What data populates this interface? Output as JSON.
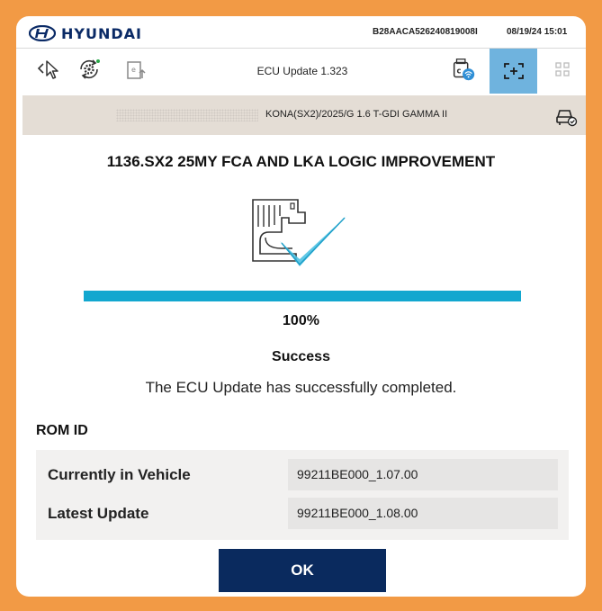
{
  "header": {
    "brand": "HYUNDAI",
    "vin": "B28AACA526240819008I",
    "datetime": "08/19/24 15:01"
  },
  "toolbar": {
    "title": "ECU Update 1.323",
    "icons": [
      "pointer-back-icon",
      "settings-sync-icon",
      "ecu-upload-icon",
      "vci-status-icon",
      "screen-capture-icon",
      "grid-icon"
    ]
  },
  "vehicle": {
    "description": "KONA(SX2)/2025/G 1.6 T-GDI GAMMA II"
  },
  "update": {
    "title": "1136.SX2 25MY FCA AND LKA LOGIC IMPROVEMENT",
    "progress": 1.0,
    "percent_text": "100%",
    "status": "Success",
    "message": "The ECU Update has successfully completed."
  },
  "rom": {
    "label": "ROM ID",
    "rows": [
      {
        "label": "Currently in Vehicle",
        "value": "99211BE000_1.07.00"
      },
      {
        "label": "Latest Update",
        "value": "99211BE000_1.08.00"
      }
    ]
  },
  "actions": {
    "ok_label": "OK"
  },
  "colors": {
    "frame_border": "#f29a45",
    "brand_navy": "#0a2a66",
    "progress": "#12a7cf",
    "active_toolbar": "#6fb3de",
    "button": "#0a2a5e"
  }
}
